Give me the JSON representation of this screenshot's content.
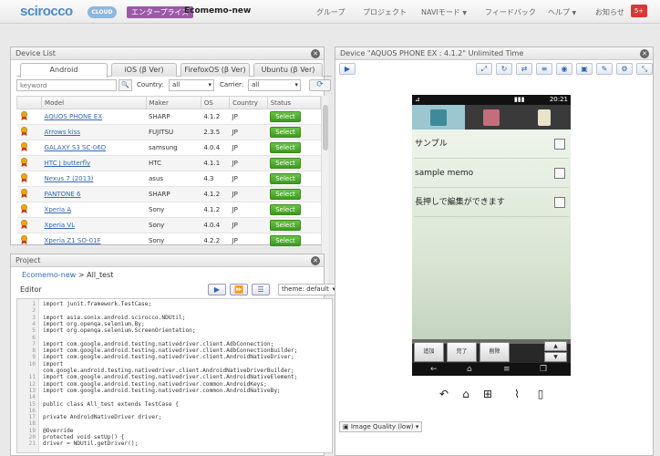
{
  "nav": {
    "logo": "scirocco",
    "cloud": "CLOUD",
    "edition": "エンタープライズ",
    "project": "Ecomemo-new",
    "menus": [
      "グループ",
      "プロジェクト",
      "NAVIモード",
      "フィードバック",
      "ヘルプ",
      "お知らせ"
    ],
    "notif_count": "5+"
  },
  "device_list": {
    "title": "Device List",
    "tabs": [
      "Android",
      "iOS (β Ver)",
      "FirefoxOS (β Ver)",
      "Ubuntu (β Ver)"
    ],
    "keyword_placeholder": "keyword",
    "country_label": "Country:",
    "country_value": "all",
    "carrier_label": "Carrier:",
    "carrier_value": "all",
    "columns": [
      "Model",
      "Maker",
      "OS",
      "Country",
      "Status"
    ],
    "select_label": "Select",
    "rows": [
      {
        "model": "AQUOS PHONE EX",
        "maker": "SHARP",
        "os": "4.1.2",
        "country": "JP"
      },
      {
        "model": "Arrows kiss",
        "maker": "FUJITSU",
        "os": "2.3.5",
        "country": "JP"
      },
      {
        "model": "GALAXY S3 SC-06D",
        "maker": "samsung",
        "os": "4.0.4",
        "country": "JP"
      },
      {
        "model": "HTC J butterfly",
        "maker": "HTC",
        "os": "4.1.1",
        "country": "JP"
      },
      {
        "model": "Nexus 7 (2013)",
        "maker": "asus",
        "os": "4.3",
        "country": "JP"
      },
      {
        "model": "PANTONE 6",
        "maker": "SHARP",
        "os": "4.1.2",
        "country": "JP"
      },
      {
        "model": "Xperia A",
        "maker": "Sony",
        "os": "4.1.2",
        "country": "JP"
      },
      {
        "model": "Xperia VL",
        "maker": "Sony",
        "os": "4.0.4",
        "country": "JP"
      },
      {
        "model": "Xperia Z1 SO-01F",
        "maker": "Sony",
        "os": "4.2.2",
        "country": "JP"
      }
    ]
  },
  "project": {
    "title": "Project",
    "crumb_link": "Ecomemo-new",
    "crumb_rest": " > All_test",
    "editor_label": "Editor",
    "theme": "theme: default",
    "code": [
      {
        "n": "1",
        "t": "import junit.framework.TestCase;"
      },
      {
        "n": "2",
        "t": ""
      },
      {
        "n": "3",
        "t": "import asia.sonix.android.scirocco.NDUtil;"
      },
      {
        "n": "4",
        "t": "import org.openqa.selenium.By;"
      },
      {
        "n": "5",
        "t": "import org.openqa.selenium.ScreenOrientation;"
      },
      {
        "n": "6",
        "t": ""
      },
      {
        "n": "7",
        "t": "import com.google.android.testing.nativedriver.client.AdbConnection;"
      },
      {
        "n": "8",
        "t": "import com.google.android.testing.nativedriver.client.AdbConnectionBuilder;"
      },
      {
        "n": "9",
        "t": "import com.google.android.testing.nativedriver.client.AndroidNativeDriver;"
      },
      {
        "n": "10",
        "t": "import"
      },
      {
        "n": "",
        "t": "com.google.android.testing.nativedriver.client.AndroidNativeDriverBuilder;"
      },
      {
        "n": "11",
        "t": "import com.google.android.testing.nativedriver.client.AndroidNativeElement;"
      },
      {
        "n": "12",
        "t": "import com.google.android.testing.nativedriver.common.AndroidKeys;"
      },
      {
        "n": "13",
        "t": "import com.google.android.testing.nativedriver.common.AndroidNativeBy;"
      },
      {
        "n": "14",
        "t": ""
      },
      {
        "n": "15",
        "t": "public class All_test extends TestCase {"
      },
      {
        "n": "16",
        "t": ""
      },
      {
        "n": "17",
        "t": "  private AndroidNativeDriver driver;"
      },
      {
        "n": "18",
        "t": ""
      },
      {
        "n": "19",
        "t": "  @Override"
      },
      {
        "n": "20",
        "t": "  protected void setUp() {"
      },
      {
        "n": "21",
        "t": "    driver = NDUtil.getDriver();"
      }
    ]
  },
  "device": {
    "title": "Device \"AQUOS PHONE EX : 4.1.2\" Unlimited Time",
    "clock": "20:21",
    "memos": [
      "サンプル",
      "sample memo",
      "長押しで編集ができます"
    ],
    "buttons": [
      "追加",
      "完了",
      "削除"
    ],
    "quality": "Image Quality (low)"
  }
}
